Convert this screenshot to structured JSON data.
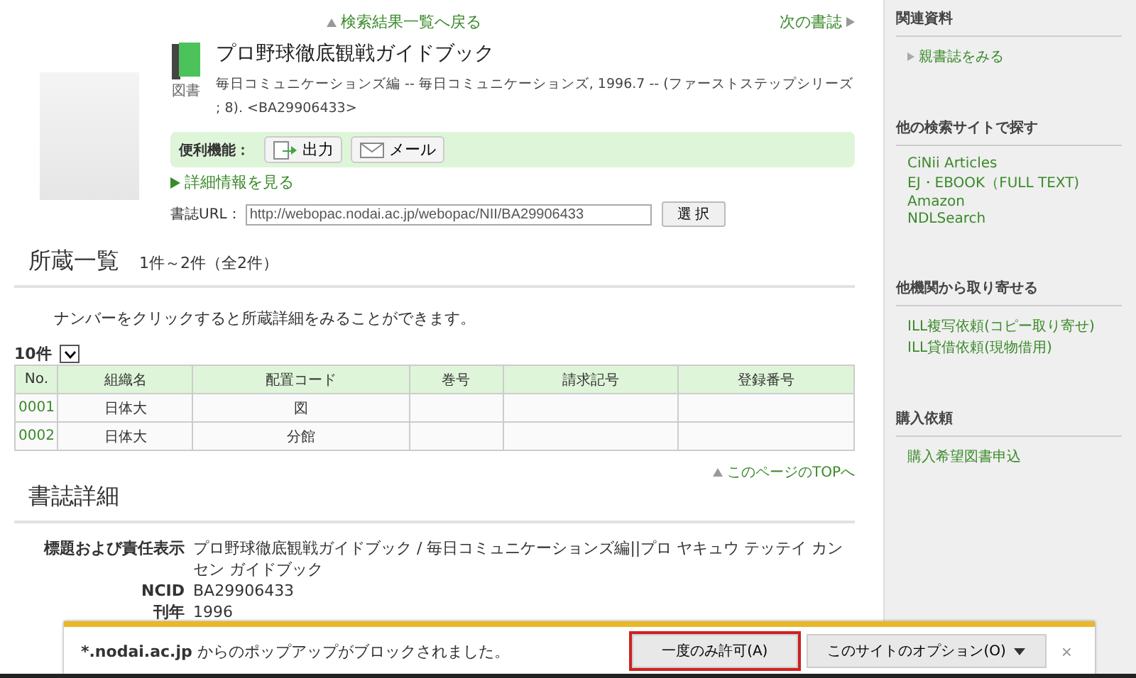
{
  "nav": {
    "back": "検索結果一覧へ戻る",
    "next": "次の書誌"
  },
  "record": {
    "type_label": "図書",
    "title": "プロ野球徹底観戦ガイドブック",
    "description": "毎日コミュニケーションズ編 -- 毎日コミュニケーションズ, 1996.7 -- (ファーストステップシリーズ ; 8). <BA29906433>"
  },
  "tools": {
    "label": "便利機能：",
    "buttons": [
      {
        "kind": "export",
        "label": "出力"
      },
      {
        "kind": "mail",
        "label": "メール"
      }
    ]
  },
  "detail_link": "詳細情報を見る",
  "url_field": {
    "label": "書誌URL：",
    "value": "http://webopac.nodai.ac.jp/webopac/NII/BA29906433",
    "button": "選 択"
  },
  "holdings": {
    "title": "所蔵一覧",
    "count": "1件～2件（全2件）",
    "hint": "ナンバーをクリックすると所蔵詳細をみることができます。",
    "page_size": "10件",
    "columns": [
      "No.",
      "組織名",
      "配置コード",
      "巻号",
      "請求記号",
      "登録番号"
    ],
    "rows": [
      {
        "no": "0001",
        "org": "日体大",
        "location": "図"
      },
      {
        "no": "0002",
        "org": "日体大",
        "location": "分館"
      }
    ]
  },
  "top_link": "このページのTOPへ",
  "bib_detail": {
    "title": "書誌詳細",
    "fields": [
      {
        "label": "標題および責任表示",
        "value": "プロ野球徹底観戦ガイドブック / 毎日コミュニケーションズ編||プロ ヤキュウ テッテイ カンセン ガイドブック"
      },
      {
        "label": "NCID",
        "value": "BA29906433"
      },
      {
        "label": "刊年",
        "value": "1996"
      }
    ]
  },
  "sidebar": {
    "sections": [
      {
        "title": "関連資料",
        "links": [
          {
            "label": "親書誌をみる",
            "arrow": true
          }
        ]
      },
      {
        "title": "他の検索サイトで探す",
        "links": [
          {
            "label": "CiNii Articles",
            "arrow": false
          },
          {
            "label": "EJ・EBOOK（FULL TEXT)",
            "arrow": false
          },
          {
            "label": "Amazon",
            "arrow": false
          },
          {
            "label": "NDLSearch",
            "arrow": false
          }
        ]
      },
      {
        "title": "他機関から取り寄せる",
        "links": [
          {
            "label": "ILL複写依頼(コピー取り寄せ)",
            "arrow": false
          },
          {
            "label": "ILL貸借依頼(現物借用)",
            "arrow": false
          }
        ]
      },
      {
        "title": "購入依頼",
        "links": [
          {
            "label": "購入希望図書申込",
            "arrow": false
          }
        ]
      }
    ]
  },
  "popup_bar": {
    "host": "*.nodai.ac.jp",
    "message": "からのポップアップがブロックされました。",
    "buttons": [
      {
        "label": "一度のみ許可(A)",
        "focused": true,
        "dropdown": false
      },
      {
        "label": "このサイトのオプション(O)",
        "focused": false,
        "dropdown": true
      }
    ],
    "close": "×"
  }
}
